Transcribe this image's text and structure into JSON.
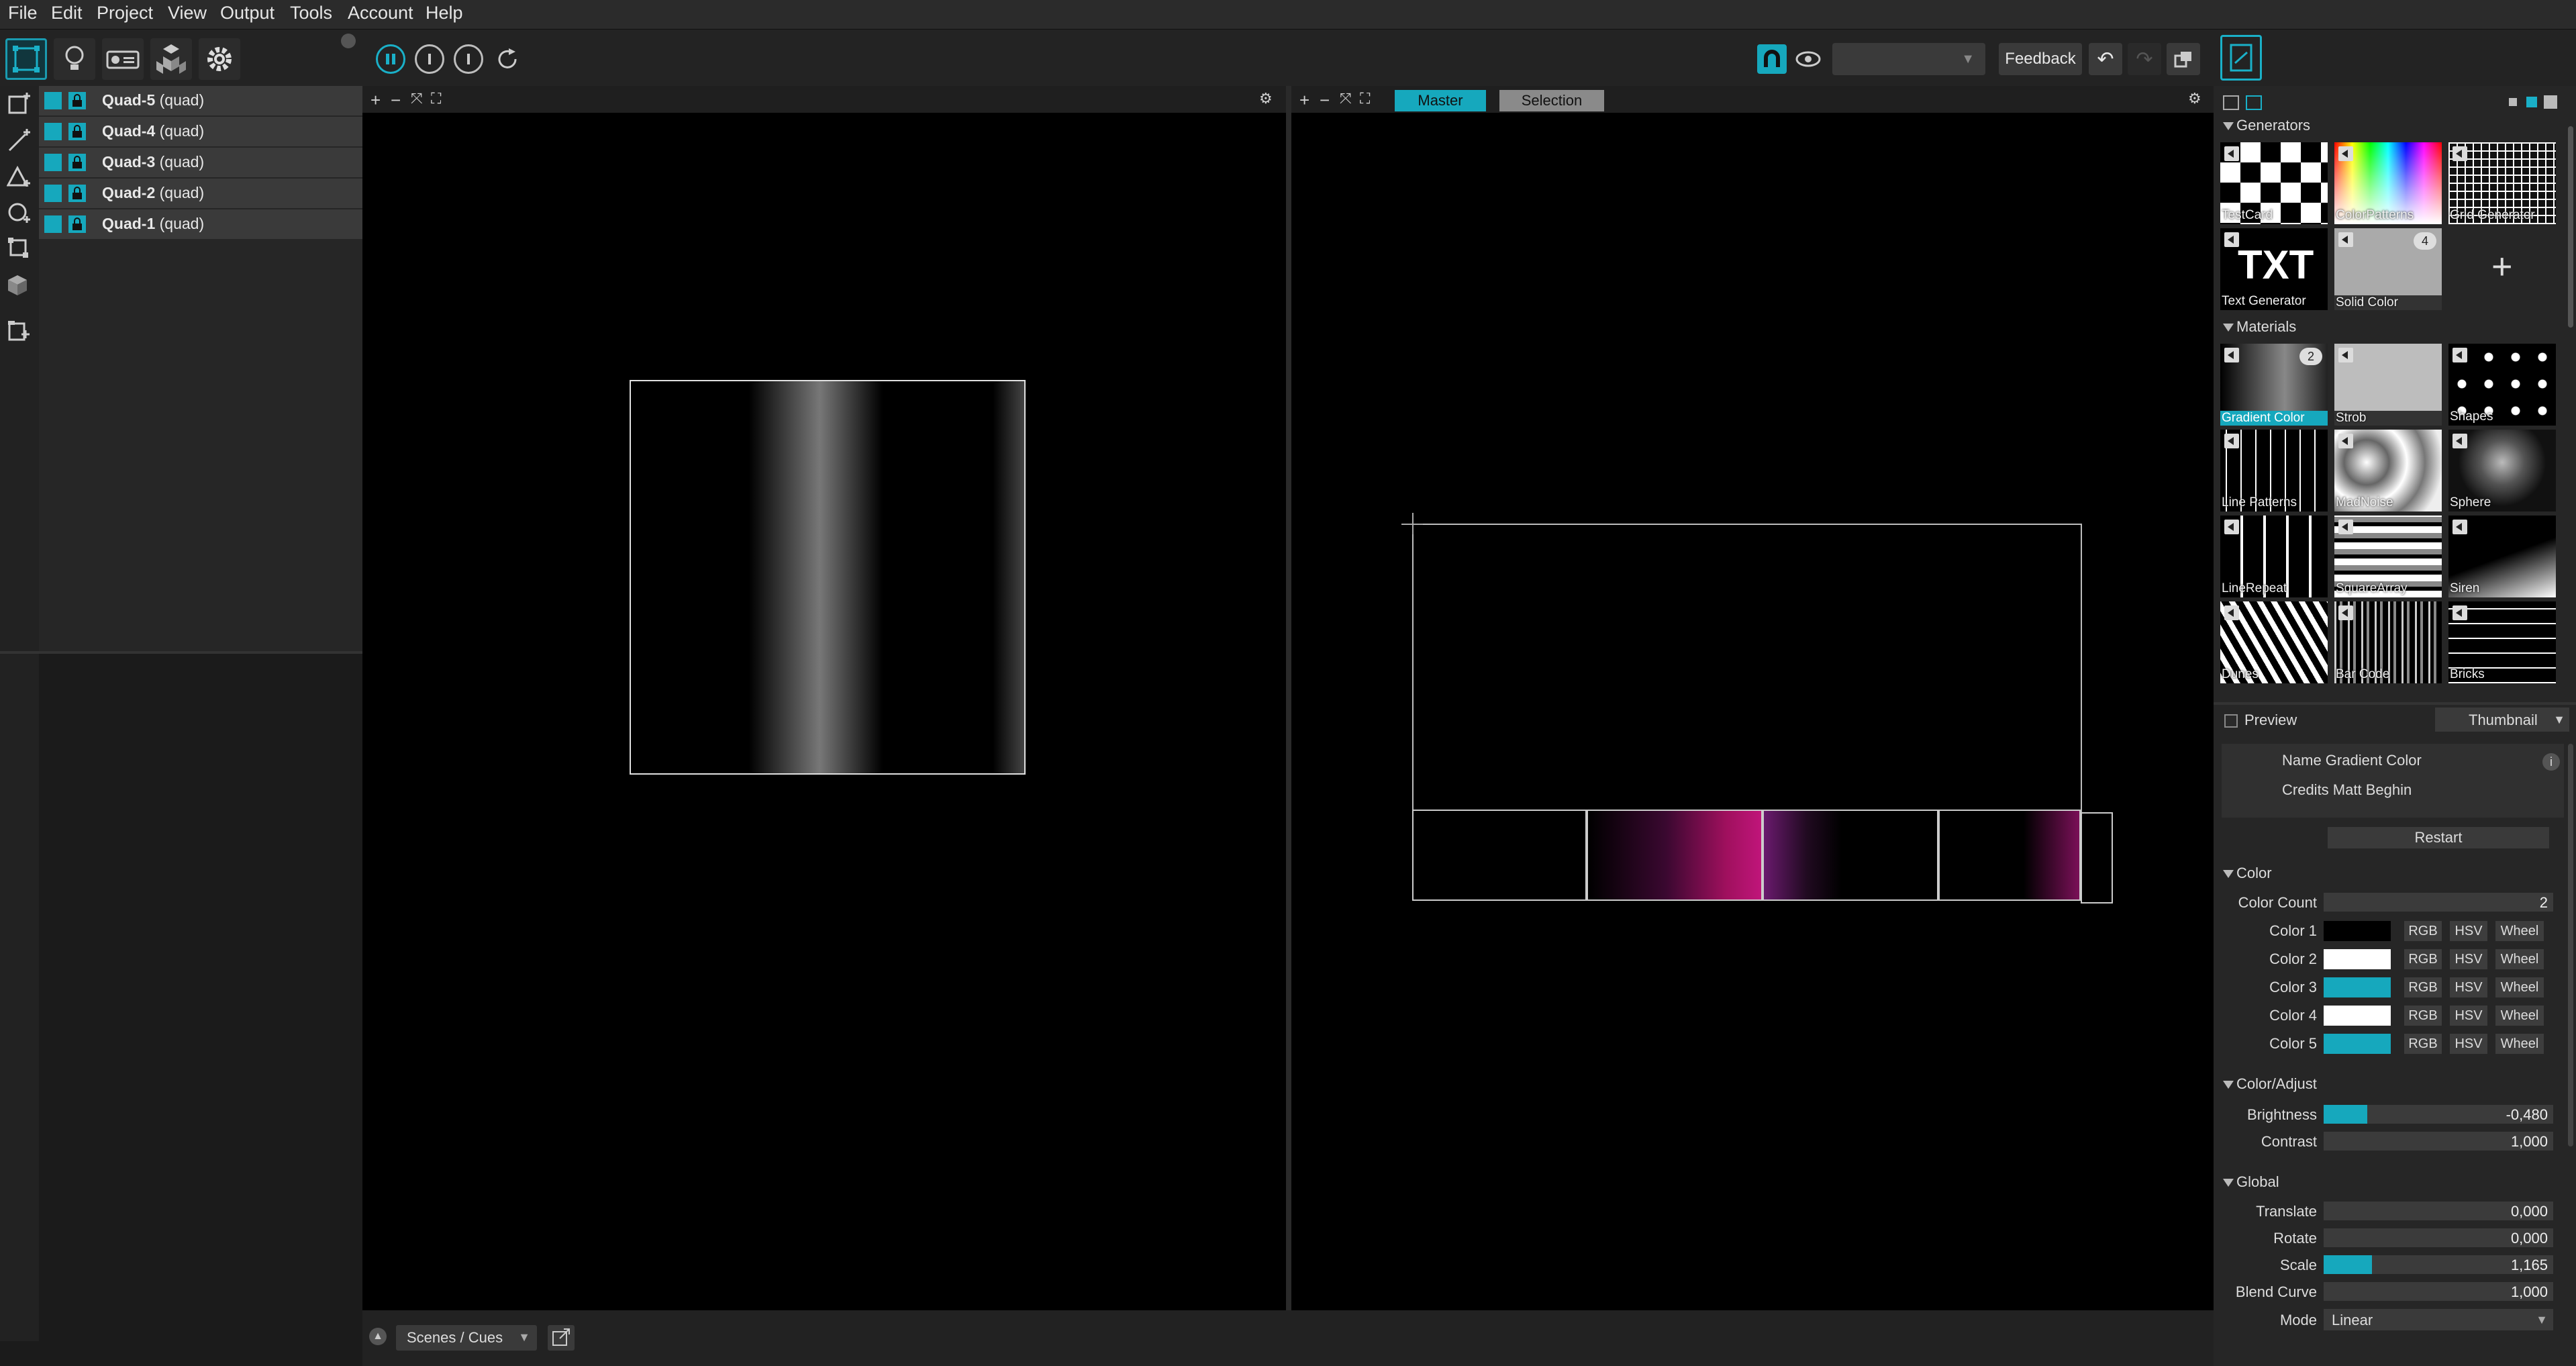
{
  "menu": [
    "File",
    "Edit",
    "Project",
    "View",
    "Output",
    "Tools",
    "Account",
    "Help"
  ],
  "toolbar": {
    "feedback_label": "Feedback",
    "dropdown_value": ""
  },
  "layers": [
    {
      "name": "Quad-5",
      "type": "(quad)"
    },
    {
      "name": "Quad-4",
      "type": "(quad)"
    },
    {
      "name": "Quad-3",
      "type": "(quad)"
    },
    {
      "name": "Quad-2",
      "type": "(quad)"
    },
    {
      "name": "Quad-1",
      "type": "(quad)"
    }
  ],
  "output_view": {
    "tab_master": "Master",
    "tab_selection": "Selection"
  },
  "generators": {
    "title": "Generators",
    "items": [
      {
        "label": "TestCard"
      },
      {
        "label": "ColorPatterns"
      },
      {
        "label": "Grid Generator"
      },
      {
        "label": "Text Generator",
        "glyph": "TXT"
      },
      {
        "label": "Solid Color",
        "badge": "4"
      },
      {
        "label": "+"
      }
    ]
  },
  "materials": {
    "title": "Materials",
    "items": [
      {
        "label": "Gradient Color",
        "badge": "2"
      },
      {
        "label": "Strob"
      },
      {
        "label": "Shapes"
      },
      {
        "label": "Line Patterns"
      },
      {
        "label": "MadNoise"
      },
      {
        "label": "Sphere"
      },
      {
        "label": "LineRepeat"
      },
      {
        "label": "SquareArray"
      },
      {
        "label": "Siren"
      },
      {
        "label": "Dunes"
      },
      {
        "label": "Bar Code"
      },
      {
        "label": "Bricks"
      }
    ]
  },
  "inspector": {
    "preview_label": "Preview",
    "preview_mode": "Thumbnail",
    "name_line": "Name Gradient Color",
    "credits_line": "Credits Matt Beghin",
    "restart_label": "Restart",
    "color_section": "Color",
    "color_count_label": "Color Count",
    "color_count_value": "2",
    "colors": [
      {
        "label": "Color 1",
        "hex": "#000000"
      },
      {
        "label": "Color 2",
        "hex": "#ffffff"
      },
      {
        "label": "Color 3",
        "hex": "#16a8bd"
      },
      {
        "label": "Color 4",
        "hex": "#ffffff"
      },
      {
        "label": "Color 5",
        "hex": "#16a8bd"
      }
    ],
    "color_mode_buttons": [
      "RGB",
      "HSV",
      "Wheel"
    ],
    "color_adjust_section": "Color/Adjust",
    "brightness": {
      "label": "Brightness",
      "value": "-0,480",
      "fill": 0.19
    },
    "contrast": {
      "label": "Contrast",
      "value": "1,000",
      "fill": 0
    },
    "global_section": "Global",
    "translate": {
      "label": "Translate",
      "value": "0,000",
      "fill": 0
    },
    "rotate": {
      "label": "Rotate",
      "value": "0,000",
      "fill": 0
    },
    "scale": {
      "label": "Scale",
      "value": "1,165",
      "fill": 0.21
    },
    "blend_curve": {
      "label": "Blend Curve",
      "value": "1,000",
      "fill": 0
    },
    "mode_label": "Mode",
    "mode_value": "Linear"
  },
  "bottom": {
    "scenes_label": "Scenes / Cues"
  },
  "colors": {
    "accent": "#16a8bd",
    "background": "#1b1b1b",
    "panel": "#262626"
  }
}
